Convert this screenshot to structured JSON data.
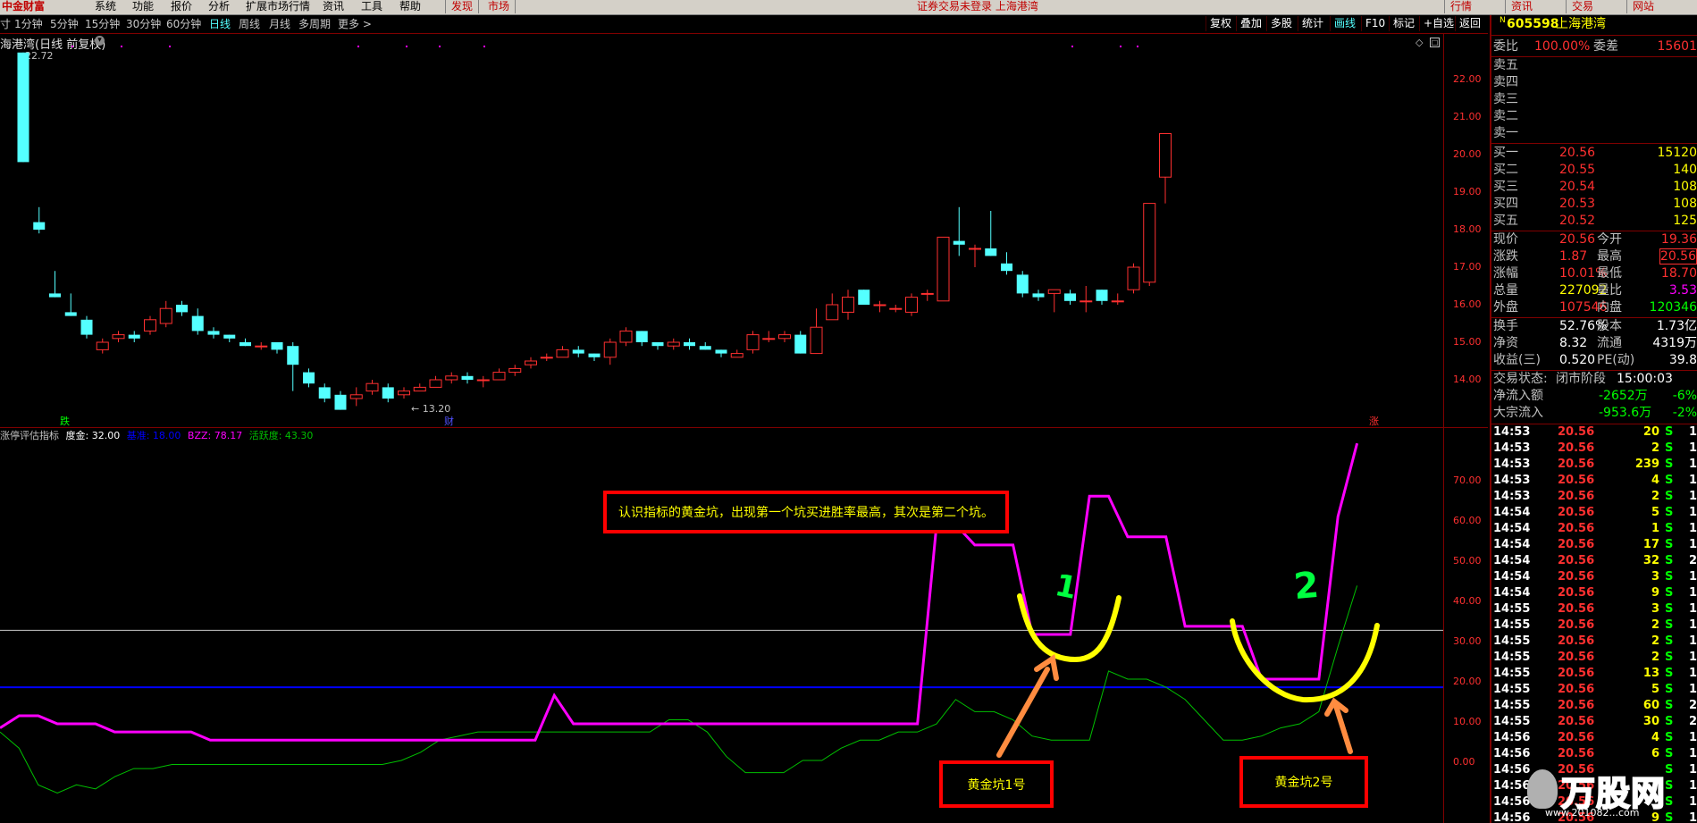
{
  "menu": {
    "logo": "中金财富",
    "items": [
      "系统",
      "功能",
      "报价",
      "分析",
      "扩展市场行情",
      "资讯",
      "工具",
      "帮助"
    ],
    "tabs": [
      "发现",
      "市场"
    ],
    "status": "证券交易未登录  上海港湾",
    "right_tabs": [
      "行情",
      "资讯",
      "交易",
      "网站"
    ]
  },
  "toolbar": {
    "left_items": [
      "寸",
      "1分钟",
      "5分钟",
      "15分钟",
      "30分钟",
      "60分钟",
      "日线",
      "周线",
      "月线",
      "多周期",
      "更多 >"
    ],
    "active": "日线",
    "right_items": [
      "复权",
      "叠加",
      "多股",
      "统计",
      "画线",
      "F10",
      "标记",
      "+自选",
      "返回"
    ]
  },
  "upper_chart": {
    "title": "海港湾(日线 前复权)",
    "high_label": "22.72",
    "low_label": "← 13.20",
    "markers": {
      "left": "跌",
      "mid": "财",
      "right": "涨"
    },
    "y_ticks": [
      "22.00",
      "21.00",
      "20.00",
      "19.00",
      "18.00",
      "17.00",
      "16.00",
      "15.00",
      "14.00"
    ]
  },
  "lower_chart": {
    "indicator_name": "涨停评估指标",
    "params": [
      {
        "label": "度金: 32.00",
        "color": "#ffffff"
      },
      {
        "label": "基准: 18.00",
        "color": "#0000ff"
      },
      {
        "label": "BZZ: 78.17",
        "color": "#ff00ff"
      },
      {
        "label": "活跃度: 43.30",
        "color": "#00c000"
      }
    ],
    "y_ticks": [
      "70.00",
      "60.00",
      "50.00",
      "40.00",
      "30.00",
      "20.00",
      "10.00",
      "0.00"
    ],
    "note": "认识指标的黄金坑，出现第一个坑买进胜率最高，其次是第二个坑。",
    "pit1_number": "1",
    "pit2_number": "2",
    "pit1_label": "黄金坑1号",
    "pit2_label": "黄金坑2号"
  },
  "chart_data": [
    {
      "type": "candlestick",
      "title": "海港湾(日线 前复权)",
      "ylim": [
        13.0,
        23.0
      ],
      "candles": [
        [
          22.72,
          19.8,
          22.72,
          19.8
        ],
        [
          18.2,
          18.0,
          18.6,
          17.9
        ],
        [
          16.3,
          16.2,
          16.9,
          16.2
        ],
        [
          15.8,
          15.7,
          16.3,
          15.7
        ],
        [
          15.6,
          15.2,
          15.7,
          15.1
        ],
        [
          14.8,
          15.0,
          15.1,
          14.7
        ],
        [
          15.1,
          15.2,
          15.3,
          15.0
        ],
        [
          15.2,
          15.1,
          15.3,
          15.0
        ],
        [
          15.3,
          15.6,
          15.7,
          15.2
        ],
        [
          15.5,
          15.9,
          16.1,
          15.4
        ],
        [
          16.0,
          15.8,
          16.1,
          15.7
        ],
        [
          15.7,
          15.3,
          15.9,
          15.2
        ],
        [
          15.3,
          15.2,
          15.4,
          15.1
        ],
        [
          15.2,
          15.1,
          15.2,
          15.0
        ],
        [
          15.0,
          14.9,
          15.1,
          14.9
        ],
        [
          14.9,
          14.9,
          15.0,
          14.8
        ],
        [
          15.0,
          14.8,
          15.0,
          14.7
        ],
        [
          14.9,
          14.4,
          15.0,
          13.7
        ],
        [
          14.2,
          13.9,
          14.3,
          13.8
        ],
        [
          13.8,
          13.5,
          13.9,
          13.4
        ],
        [
          13.6,
          13.2,
          13.7,
          13.2
        ],
        [
          13.5,
          13.6,
          13.8,
          13.3
        ],
        [
          13.7,
          13.9,
          14.0,
          13.6
        ],
        [
          13.8,
          13.5,
          13.9,
          13.4
        ],
        [
          13.6,
          13.7,
          13.8,
          13.5
        ],
        [
          13.7,
          13.8,
          13.9,
          13.7
        ],
        [
          13.8,
          14.0,
          14.1,
          13.8
        ],
        [
          14.0,
          14.1,
          14.2,
          13.9
        ],
        [
          14.1,
          14.0,
          14.2,
          13.9
        ],
        [
          14.0,
          14.0,
          14.1,
          13.8
        ],
        [
          14.0,
          14.2,
          14.3,
          14.0
        ],
        [
          14.2,
          14.3,
          14.4,
          14.1
        ],
        [
          14.4,
          14.5,
          14.6,
          14.3
        ],
        [
          14.6,
          14.6,
          14.7,
          14.5
        ],
        [
          14.6,
          14.8,
          14.9,
          14.6
        ],
        [
          14.8,
          14.7,
          14.9,
          14.6
        ],
        [
          14.7,
          14.6,
          14.7,
          14.5
        ],
        [
          14.6,
          15.0,
          15.1,
          14.4
        ],
        [
          15.0,
          15.3,
          15.4,
          14.9
        ],
        [
          15.3,
          15.0,
          15.3,
          14.9
        ],
        [
          15.0,
          14.9,
          15.0,
          14.8
        ],
        [
          14.9,
          15.0,
          15.1,
          14.8
        ],
        [
          15.0,
          14.9,
          15.1,
          14.8
        ],
        [
          14.9,
          14.8,
          15.0,
          14.8
        ],
        [
          14.8,
          14.7,
          14.8,
          14.6
        ],
        [
          14.6,
          14.7,
          14.8,
          14.6
        ],
        [
          14.8,
          15.2,
          15.3,
          14.7
        ],
        [
          15.1,
          15.1,
          15.3,
          15.0
        ],
        [
          15.1,
          15.2,
          15.3,
          15.0
        ],
        [
          15.2,
          14.7,
          15.3,
          14.7
        ],
        [
          14.7,
          15.4,
          15.9,
          14.7
        ],
        [
          15.6,
          16.0,
          16.3,
          15.6
        ],
        [
          15.8,
          16.2,
          16.4,
          15.6
        ],
        [
          16.4,
          16.0,
          16.4,
          16.0
        ],
        [
          16.0,
          16.0,
          16.1,
          15.8
        ],
        [
          15.9,
          15.9,
          16.0,
          15.8
        ],
        [
          15.8,
          16.2,
          16.3,
          15.7
        ],
        [
          16.3,
          16.3,
          16.4,
          16.1
        ],
        [
          16.1,
          17.8,
          17.8,
          16.1
        ],
        [
          17.7,
          17.6,
          18.6,
          17.3
        ],
        [
          17.5,
          17.5,
          17.6,
          17.0
        ],
        [
          17.5,
          17.3,
          18.5,
          17.3
        ],
        [
          17.1,
          16.9,
          17.4,
          16.8
        ],
        [
          16.8,
          16.3,
          16.9,
          16.2
        ],
        [
          16.3,
          16.2,
          16.4,
          16.1
        ],
        [
          16.3,
          16.4,
          16.4,
          15.8
        ],
        [
          16.3,
          16.1,
          16.4,
          16.0
        ],
        [
          16.1,
          16.1,
          16.5,
          15.8
        ],
        [
          16.4,
          16.1,
          16.4,
          16.0
        ],
        [
          16.1,
          16.1,
          16.3,
          16.0
        ],
        [
          16.4,
          17.0,
          17.1,
          16.3
        ],
        [
          16.6,
          18.7,
          18.7,
          16.5
        ],
        [
          19.4,
          20.56,
          20.56,
          18.7
        ]
      ]
    },
    {
      "type": "line",
      "title": "涨停评估指标",
      "ylim": [
        -10,
        80
      ],
      "series": [
        {
          "name": "度金",
          "values": [
            32.0
          ]
        },
        {
          "name": "基准",
          "values": [
            18.0
          ]
        },
        {
          "name": "BZZ",
          "values": [
            8,
            11,
            11,
            9,
            9,
            9,
            7,
            7,
            7,
            7,
            7,
            5,
            5,
            5,
            5,
            5,
            5,
            5,
            5,
            5,
            5,
            5,
            5,
            5,
            5,
            5,
            5,
            5,
            5,
            16,
            9,
            9,
            9,
            9,
            9,
            9,
            9,
            9,
            9,
            9,
            9,
            9,
            9,
            9,
            9,
            9,
            9,
            9,
            9,
            58,
            58,
            53,
            53,
            53,
            31,
            31,
            31,
            65,
            65,
            55,
            55,
            55,
            33,
            33,
            33,
            33,
            20,
            20,
            20,
            20,
            60,
            78
          ]
        },
        {
          "name": "活跃度",
          "values": [
            7,
            3,
            -6,
            -8,
            -6,
            -7,
            -4,
            -2,
            -2,
            -1,
            -1,
            -1,
            -1,
            -1,
            -1,
            -1,
            -1,
            -1,
            -1,
            -1,
            -1,
            0,
            2,
            5,
            6,
            7,
            7,
            7,
            7,
            7,
            7,
            7,
            7,
            7,
            7,
            10,
            10,
            7,
            1,
            -3,
            -3,
            -3,
            0,
            0,
            3,
            5,
            5,
            7,
            7,
            9,
            15,
            12,
            12,
            10,
            6,
            5,
            5,
            5,
            22,
            20,
            20,
            18,
            15,
            10,
            5,
            5,
            6,
            8,
            9,
            12,
            28,
            43
          ]
        }
      ]
    }
  ],
  "quote": {
    "code": "605598",
    "name": "上海港湾",
    "weibi_label": "委比",
    "weibi": "100.00%",
    "weicha_label": "委差",
    "weicha": "15601",
    "sells": [
      "卖五",
      "卖四",
      "卖三",
      "卖二",
      "卖一"
    ],
    "buys": [
      {
        "label": "买一",
        "price": "20.56",
        "vol": "15120"
      },
      {
        "label": "买二",
        "price": "20.55",
        "vol": "140"
      },
      {
        "label": "买三",
        "price": "20.54",
        "vol": "108"
      },
      {
        "label": "买四",
        "price": "20.53",
        "vol": "108"
      },
      {
        "label": "买五",
        "price": "20.52",
        "vol": "125"
      }
    ],
    "stats": [
      {
        "l1": "现价",
        "v1": "20.56",
        "l2": "今开",
        "v2": "19.36"
      },
      {
        "l1": "涨跌",
        "v1": "1.87",
        "l2": "最高",
        "v2": "20.56"
      },
      {
        "l1": "涨幅",
        "v1": "10.01%",
        "l2": "最低",
        "v2": "18.70"
      },
      {
        "l1": "总量",
        "v1": "227092",
        "l2": "量比",
        "v2": "3.53"
      },
      {
        "l1": "外盘",
        "v1": "107546",
        "l2": "内盘",
        "v2": "120346"
      }
    ],
    "stats2": [
      {
        "l1": "换手",
        "v1": "52.76%",
        "l2": "股本",
        "v2": "1.73亿"
      },
      {
        "l1": "净资",
        "v1": "8.32",
        "l2": "流通",
        "v2": "4319万"
      },
      {
        "l1": "收益(三)",
        "v1": "0.520",
        "l2": "PE(动)",
        "v2": "39.8"
      }
    ],
    "trade_state_label": "交易状态:",
    "trade_state": "闭市阶段",
    "trade_time": "15:00:03",
    "flow": [
      {
        "label": "净流入额",
        "value": "-2652万",
        "pct": "-6%"
      },
      {
        "label": "大宗流入",
        "value": "-953.6万",
        "pct": "-2%"
      }
    ]
  },
  "ticks": [
    [
      "14:53",
      "20.56",
      "20",
      "S",
      "1"
    ],
    [
      "14:53",
      "20.56",
      "2",
      "S",
      "1"
    ],
    [
      "14:53",
      "20.56",
      "239",
      "S",
      "1"
    ],
    [
      "14:53",
      "20.56",
      "4",
      "S",
      "1"
    ],
    [
      "14:53",
      "20.56",
      "2",
      "S",
      "1"
    ],
    [
      "14:54",
      "20.56",
      "5",
      "S",
      "1"
    ],
    [
      "14:54",
      "20.56",
      "1",
      "S",
      "1"
    ],
    [
      "14:54",
      "20.56",
      "17",
      "S",
      "1"
    ],
    [
      "14:54",
      "20.56",
      "32",
      "S",
      "2"
    ],
    [
      "14:54",
      "20.56",
      "3",
      "S",
      "1"
    ],
    [
      "14:54",
      "20.56",
      "9",
      "S",
      "1"
    ],
    [
      "14:55",
      "20.56",
      "3",
      "S",
      "1"
    ],
    [
      "14:55",
      "20.56",
      "2",
      "S",
      "1"
    ],
    [
      "14:55",
      "20.56",
      "2",
      "S",
      "1"
    ],
    [
      "14:55",
      "20.56",
      "2",
      "S",
      "1"
    ],
    [
      "14:55",
      "20.56",
      "13",
      "S",
      "1"
    ],
    [
      "14:55",
      "20.56",
      "5",
      "S",
      "1"
    ],
    [
      "14:55",
      "20.56",
      "60",
      "S",
      "2"
    ],
    [
      "14:55",
      "20.56",
      "30",
      "S",
      "2"
    ],
    [
      "14:56",
      "20.56",
      "4",
      "S",
      "1"
    ],
    [
      "14:56",
      "20.56",
      "6",
      "S",
      "1"
    ],
    [
      "14:56",
      "20.56",
      "",
      "S",
      "1"
    ],
    [
      "14:56",
      "20.56",
      "",
      "S",
      "1"
    ],
    [
      "14:56",
      "20.56",
      "",
      "S",
      "1"
    ],
    [
      "14:56",
      "20.56",
      "9",
      "S",
      "1"
    ]
  ],
  "watermark": {
    "text": "万股网",
    "url": "www.201082...com"
  },
  "colors": {
    "up": "#ff3030",
    "down": "#54ffff",
    "bzz": "#ff00ff",
    "active": "#00c000",
    "dujin": "#c8c8c8",
    "jizhun": "#0000ff",
    "annotation_border": "#ff0000",
    "annotation_text": "#ffff00",
    "pit_curve": "#ffff00",
    "arrow": "#ff8c40"
  }
}
